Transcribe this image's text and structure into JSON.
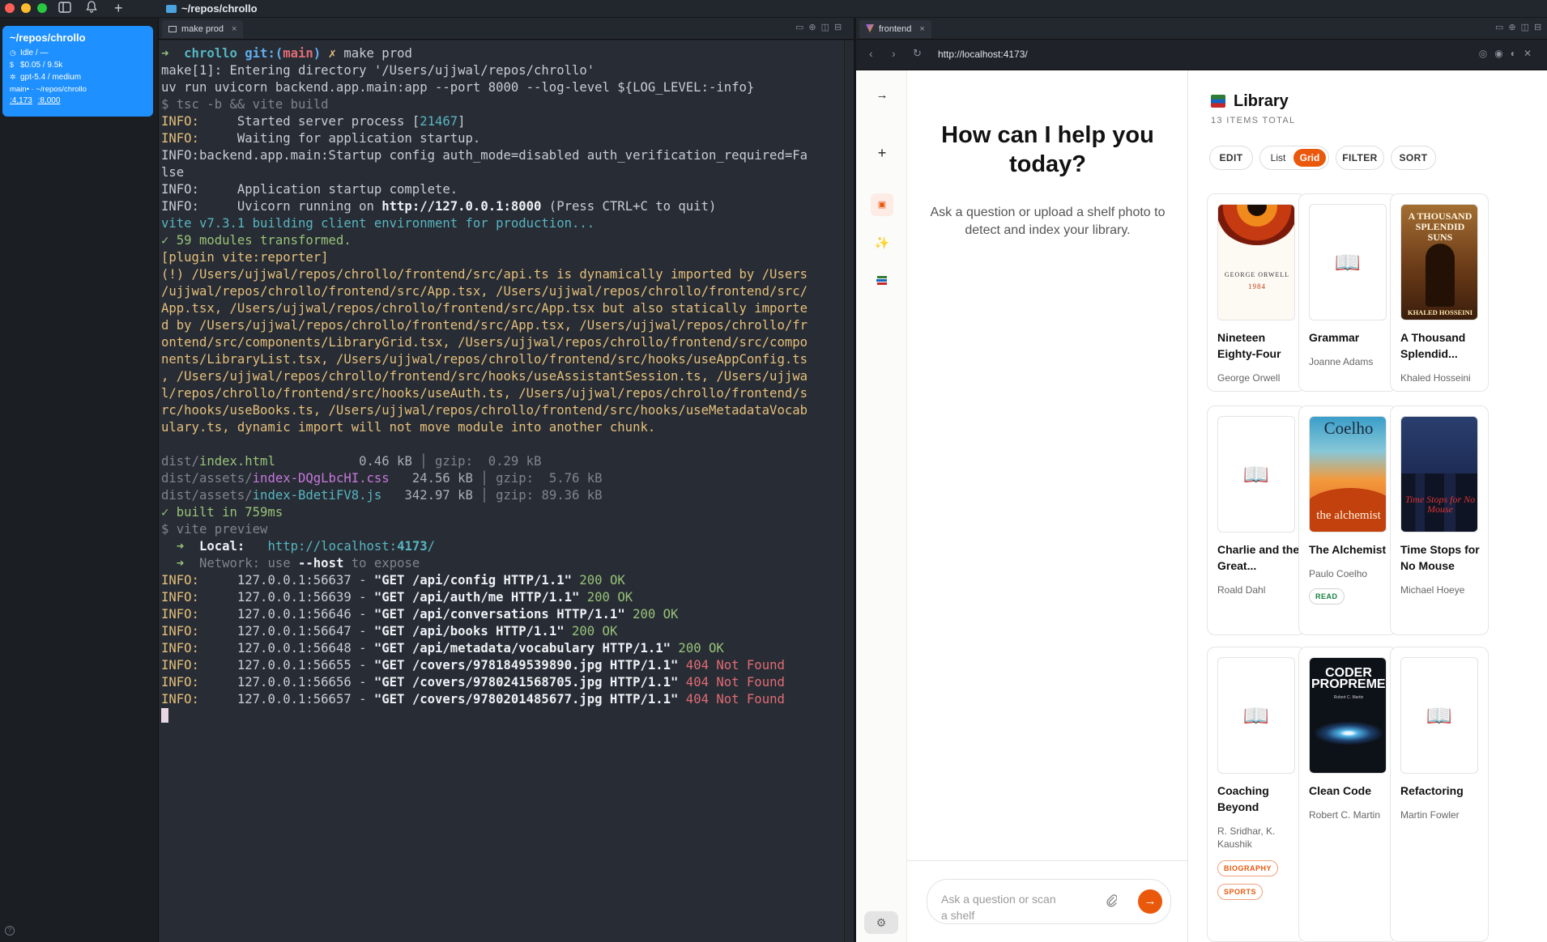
{
  "app": {
    "window_title": "~/repos/chrollo",
    "sidebar": {
      "workspace_title": "~/repos/chrollo",
      "status": "Idle / —",
      "cost": "$0.05 / 9.5k",
      "model": "gpt-5.4 / medium",
      "branch_path": "main• · ~/repos/chrollo",
      "ports": [
        ":4,173",
        ":8,000"
      ]
    }
  },
  "terminal": {
    "tab_label": "make prod",
    "prompt": {
      "dir": "chrollo",
      "git": "git:(",
      "branch": "main",
      "git_close": ")",
      "mark": "✗",
      "command": "make prod"
    },
    "lines_a": [
      "make[1]: Entering directory '/Users/ujjwal/repos/chrollo'",
      "uv run uvicorn backend.app.main:app --port 8000 --log-level ${LOG_LEVEL:-info}"
    ],
    "build_cmd": "$ tsc -b && vite build",
    "info_a": [
      {
        "tag": "INFO:",
        "pre": "     Started server process [",
        "num": "21467",
        "post": "]"
      },
      {
        "tag": "INFO:",
        "pre": "     Waiting for application startup.",
        "num": "",
        "post": ""
      }
    ],
    "startup_line_1": "INFO:backend.app.main:Startup config auth_mode=disabled auth_verification_required=Fa",
    "startup_line_2": "lse",
    "complete_line": "INFO:     Application startup complete.",
    "uvicorn": {
      "pre": "INFO:     Uvicorn running on ",
      "url": "http://127.0.0.1:8000",
      "post": " (Press CTRL+C to quit)"
    },
    "vite_building": "vite v7.3.1 building client environment for production...",
    "modules": "✓ 59 modules transformed.",
    "reporter": "[plugin vite:reporter]",
    "warning_lines": [
      "(!) /Users/ujjwal/repos/chrollo/frontend/src/api.ts is dynamically imported by /Users",
      "/ujjwal/repos/chrollo/frontend/src/App.tsx, /Users/ujjwal/repos/chrollo/frontend/src/",
      "App.tsx, /Users/ujjwal/repos/chrollo/frontend/src/App.tsx but also statically importe",
      "d by /Users/ujjwal/repos/chrollo/frontend/src/App.tsx, /Users/ujjwal/repos/chrollo/fr",
      "ontend/src/components/LibraryGrid.tsx, /Users/ujjwal/repos/chrollo/frontend/src/compo",
      "nents/LibraryList.tsx, /Users/ujjwal/repos/chrollo/frontend/src/hooks/useAppConfig.ts",
      ", /Users/ujjwal/repos/chrollo/frontend/src/hooks/useAssistantSession.ts, /Users/ujjwa",
      "l/repos/chrollo/frontend/src/hooks/useAuth.ts, /Users/ujjwal/repos/chrollo/frontend/s",
      "rc/hooks/useBooks.ts, /Users/ujjwal/repos/chrollo/frontend/src/hooks/useMetadataVocab",
      "ulary.ts, dynamic import will not move module into another chunk."
    ],
    "dist": [
      {
        "dir": "dist/",
        "file": "index.html",
        "size": "           0.46 kB",
        "gzip": "gzip:  0.29 kB",
        "kind": "html"
      },
      {
        "dir": "dist/assets/",
        "file": "index-DQgLbcHI.css",
        "size": "   24.56 kB",
        "gzip": "gzip:  5.76 kB",
        "kind": "css"
      },
      {
        "dir": "dist/assets/",
        "file": "index-BdetiFV8.js",
        "size": "   342.97 kB",
        "gzip": "gzip: 89.36 kB",
        "kind": "js"
      }
    ],
    "built": "✓ built in 759ms",
    "preview_cmd": "$ vite preview",
    "local": {
      "arrow": "  ➜  ",
      "label": "Local:",
      "gap": "   ",
      "url_a": "http://localhost:",
      "port": "4173",
      "url_b": "/"
    },
    "network": {
      "arrow": "  ➜  ",
      "label": "Network:",
      "use": " use ",
      "host": "--host",
      "tail": " to expose"
    },
    "requests": [
      {
        "tag": "INFO:",
        "addr": "     127.0.0.1:56637 - ",
        "req": "\"GET /api/config HTTP/1.1\"",
        "status": " 200 OK",
        "ok": true
      },
      {
        "tag": "INFO:",
        "addr": "     127.0.0.1:56639 - ",
        "req": "\"GET /api/auth/me HTTP/1.1\"",
        "status": " 200 OK",
        "ok": true
      },
      {
        "tag": "INFO:",
        "addr": "     127.0.0.1:56646 - ",
        "req": "\"GET /api/conversations HTTP/1.1\"",
        "status": " 200 OK",
        "ok": true
      },
      {
        "tag": "INFO:",
        "addr": "     127.0.0.1:56647 - ",
        "req": "\"GET /api/books HTTP/1.1\"",
        "status": " 200 OK",
        "ok": true
      },
      {
        "tag": "INFO:",
        "addr": "     127.0.0.1:56648 - ",
        "req": "\"GET /api/metadata/vocabulary HTTP/1.1\"",
        "status": " 200 OK",
        "ok": true
      },
      {
        "tag": "INFO:",
        "addr": "     127.0.0.1:56655 - ",
        "req": "\"GET /covers/9781849539890.jpg HTTP/1.1\"",
        "status": " 404 Not Found",
        "ok": false
      },
      {
        "tag": "INFO:",
        "addr": "     127.0.0.1:56656 - ",
        "req": "\"GET /covers/9780241568705.jpg HTTP/1.1\"",
        "status": " 404 Not Found",
        "ok": false
      },
      {
        "tag": "INFO:",
        "addr": "     127.0.0.1:56657 - ",
        "req": "\"GET /covers/9780201485677.jpg HTTP/1.1\"",
        "status": " 404 Not Found",
        "ok": false
      }
    ]
  },
  "browser": {
    "tab_label": "frontend",
    "url": "http://localhost:4173/",
    "chat": {
      "heading": "How can I help you today?",
      "subtext": "Ask a question or upload a shelf photo to detect and index your library.",
      "input_placeholder": "Ask a question or scan a shelf"
    },
    "library": {
      "title": "Library",
      "count": "13 ITEMS TOTAL",
      "edit": "EDIT",
      "view_list": "List",
      "view_grid": "Grid",
      "view_selected": "Grid",
      "filter": "FILTER",
      "sort": "SORT",
      "books": [
        {
          "title": "Nineteen Eighty-Four",
          "author": "George Orwell",
          "tags": [],
          "cover": "orwell",
          "cover_text": {
            "author": "GEORGE ORWELL",
            "title": "1984"
          }
        },
        {
          "title": "Grammar",
          "author": "Joanne Adams",
          "tags": [],
          "cover": "placeholder"
        },
        {
          "title": "A Thousand Splendid...",
          "author": "Khaled Hosseini",
          "tags": [],
          "cover": "hosseini",
          "cover_text": {
            "title": "A THOUSAND SPLENDID SUNS",
            "author": "KHALED HOSSEINI"
          }
        },
        {
          "title": "Charlie and the Great...",
          "author": "Roald Dahl",
          "tags": [],
          "cover": "placeholder"
        },
        {
          "title": "The Alchemist",
          "author": "Paulo Coelho",
          "tags": [
            {
              "label": "READ",
              "style": "read"
            }
          ],
          "cover": "alchemist",
          "cover_text": {
            "author": "Coelho",
            "title": "the alchemist"
          }
        },
        {
          "title": "Time Stops for No Mouse",
          "author": "Michael Hoeye",
          "tags": [],
          "cover": "mouse",
          "cover_text": {
            "title": "Time Stops for No Mouse"
          }
        },
        {
          "title": "Coaching Beyond",
          "author": "R. Sridhar, K. Kaushik",
          "tags": [
            {
              "label": "BIOGRAPHY",
              "style": "orange"
            },
            {
              "label": "SPORTS",
              "style": "orange"
            }
          ],
          "cover": "placeholder"
        },
        {
          "title": "Clean Code",
          "author": "Robert C. Martin",
          "tags": [],
          "cover": "cleancode",
          "cover_text": {
            "title": "CODER PROPREMENT",
            "author": "Robert C. Martin"
          }
        },
        {
          "title": "Refactoring",
          "author": "Martin Fowler",
          "tags": [],
          "cover": "placeholder"
        }
      ]
    }
  }
}
